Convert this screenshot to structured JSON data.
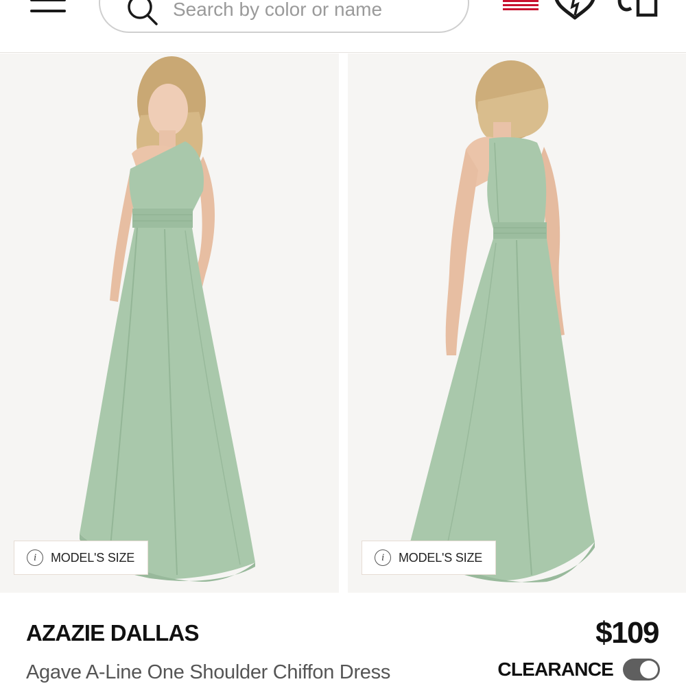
{
  "header": {
    "menu_icon": "hamburger-menu-icon",
    "search_placeholder": "Search by color or name",
    "search_icon": "search-icon",
    "country_flag_icon": "us-flag-icon",
    "wishlist_icon": "heart-icon",
    "cart_icon": "shopping-bag-icon"
  },
  "gallery": {
    "images": [
      {
        "view": "front",
        "model_size_label": "MODEL'S SIZE"
      },
      {
        "view": "back",
        "model_size_label": "MODEL'S SIZE"
      }
    ],
    "info_icon": "info-icon",
    "dress_color": "#a9c8ab"
  },
  "product": {
    "brand": "AZAZIE DALLAS",
    "name": "Agave A-Line One Shoulder Chiffon Dress",
    "price": "$109",
    "clearance_label": "CLEARANCE",
    "clearance_toggle_on": true
  },
  "colors": {
    "text_primary": "#111111",
    "text_secondary": "#555555",
    "toggle": "#5f5f5f"
  }
}
